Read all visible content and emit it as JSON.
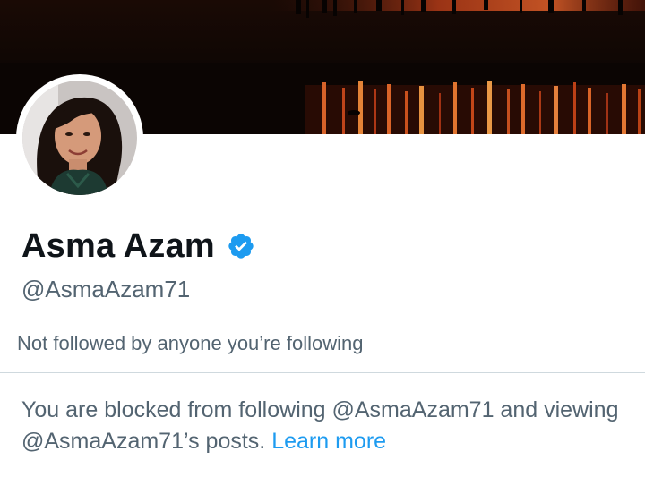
{
  "profile": {
    "display_name": "Asma Azam",
    "handle": "@AsmaAzam71",
    "verified_badge_icon": "verified-checkmark-icon",
    "verified_color": "#1d9bf0"
  },
  "followers_note": "Not followed by anyone you’re following",
  "blocked_notice": {
    "text": "You are blocked from following @AsmaAzam71 and viewing @AsmaAzam71’s posts.",
    "link_label": "Learn more"
  },
  "colors": {
    "primary_text": "#0f1419",
    "secondary_text": "#536471",
    "link": "#1d9bf0",
    "divider": "#cfd9de"
  }
}
